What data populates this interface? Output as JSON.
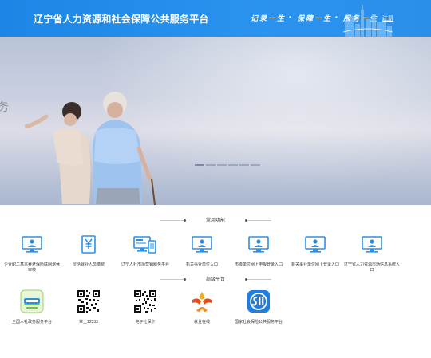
{
  "header": {
    "site_title": "辽宁省人力资源和社会保障公共服务平台",
    "slogans": [
      "记录一生",
      "保障一生",
      "服务一生"
    ],
    "register_label": "注册",
    "brand_color": "#1c86e6"
  },
  "banner": {
    "edge_char": "务",
    "slide_count": 6,
    "active_slide": 1
  },
  "common_functions": {
    "title": "常用功能",
    "items": [
      {
        "label": "企业职工基本养老保险联网退休审核",
        "icon": "monitor-person-icon"
      },
      {
        "label": "灵活就业人员缴费",
        "icon": "document-yen-icon"
      },
      {
        "label": "辽宁人社市场营销服务平台",
        "icon": "computer-phone-icon"
      },
      {
        "label": "机关事业单位入口",
        "icon": "monitor-person-icon"
      },
      {
        "label": "市级单位网上申报登录入口",
        "icon": "monitor-person-icon"
      },
      {
        "label": "机关事业单位网上登录入口",
        "icon": "monitor-person-icon"
      },
      {
        "label": "辽宁省人力资源市场信息系统入口",
        "icon": "monitor-person-icon"
      }
    ]
  },
  "partner_platforms": {
    "title": "部级平台",
    "items": [
      {
        "label": "全国人社政务服务平台",
        "icon": "national-hrss-logo"
      },
      {
        "label": "掌上12333",
        "icon": "qr-code"
      },
      {
        "label": "电子社保卡",
        "icon": "qr-code"
      },
      {
        "label": "就业在线",
        "icon": "employment-online-logo"
      },
      {
        "label": "国家社会保险公共服务平台",
        "icon": "social-insurance-logo"
      }
    ]
  }
}
